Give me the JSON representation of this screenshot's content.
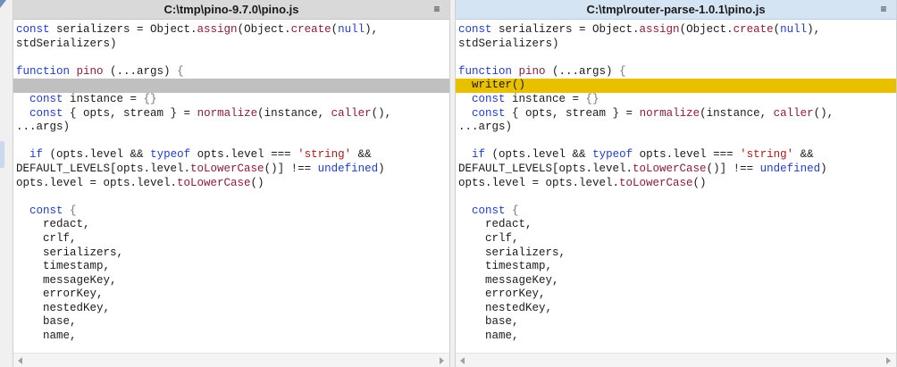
{
  "panes": [
    {
      "title": "C:\\tmp\\pino-9.7.0\\pino.js",
      "menu_glyph": "≡",
      "lines": [
        {
          "kind": "normal",
          "tokens": [
            {
              "t": "const",
              "c": "kw"
            },
            {
              "t": " serializers = Object.",
              "c": ""
            },
            {
              "t": "assign",
              "c": "fn"
            },
            {
              "t": "(Object.",
              "c": ""
            },
            {
              "t": "create",
              "c": "fn"
            },
            {
              "t": "(",
              "c": ""
            },
            {
              "t": "null",
              "c": "kw"
            },
            {
              "t": "),",
              "c": ""
            }
          ]
        },
        {
          "kind": "normal",
          "tokens": [
            {
              "t": "stdSerializers)",
              "c": ""
            }
          ]
        },
        {
          "kind": "normal",
          "tokens": []
        },
        {
          "kind": "normal",
          "tokens": [
            {
              "t": "function",
              "c": "kw"
            },
            {
              "t": " ",
              "c": ""
            },
            {
              "t": "pino",
              "c": "fn"
            },
            {
              "t": " (...args) ",
              "c": ""
            },
            {
              "t": "{",
              "c": "punc"
            }
          ]
        },
        {
          "kind": "placeholder",
          "tokens": []
        },
        {
          "kind": "normal",
          "tokens": [
            {
              "t": "  ",
              "c": ""
            },
            {
              "t": "const",
              "c": "kw"
            },
            {
              "t": " instance = ",
              "c": ""
            },
            {
              "t": "{}",
              "c": "punc"
            }
          ]
        },
        {
          "kind": "normal",
          "tokens": [
            {
              "t": "  ",
              "c": ""
            },
            {
              "t": "const",
              "c": "kw"
            },
            {
              "t": " { opts, stream } = ",
              "c": ""
            },
            {
              "t": "normalize",
              "c": "fn"
            },
            {
              "t": "(instance, ",
              "c": ""
            },
            {
              "t": "caller",
              "c": "fn"
            },
            {
              "t": "(),",
              "c": ""
            }
          ]
        },
        {
          "kind": "normal",
          "tokens": [
            {
              "t": "...args)",
              "c": ""
            }
          ]
        },
        {
          "kind": "normal",
          "tokens": []
        },
        {
          "kind": "normal",
          "tokens": [
            {
              "t": "  ",
              "c": ""
            },
            {
              "t": "if",
              "c": "kw"
            },
            {
              "t": " (opts.level && ",
              "c": ""
            },
            {
              "t": "typeof",
              "c": "kw"
            },
            {
              "t": " opts.level === ",
              "c": ""
            },
            {
              "t": "'string'",
              "c": "str"
            },
            {
              "t": " &&",
              "c": ""
            }
          ]
        },
        {
          "kind": "normal",
          "tokens": [
            {
              "t": "DEFAULT_LEVELS[opts.level.",
              "c": ""
            },
            {
              "t": "toLowerCase",
              "c": "fn"
            },
            {
              "t": "()] !== ",
              "c": ""
            },
            {
              "t": "undefined",
              "c": "kw"
            },
            {
              "t": ")",
              "c": ""
            }
          ]
        },
        {
          "kind": "normal",
          "tokens": [
            {
              "t": "opts.level = opts.level.",
              "c": ""
            },
            {
              "t": "toLowerCase",
              "c": "fn"
            },
            {
              "t": "()",
              "c": ""
            }
          ]
        },
        {
          "kind": "normal",
          "tokens": []
        },
        {
          "kind": "normal",
          "tokens": [
            {
              "t": "  ",
              "c": ""
            },
            {
              "t": "const",
              "c": "kw"
            },
            {
              "t": " ",
              "c": ""
            },
            {
              "t": "{",
              "c": "punc"
            }
          ]
        },
        {
          "kind": "normal",
          "tokens": [
            {
              "t": "    redact,",
              "c": ""
            }
          ]
        },
        {
          "kind": "normal",
          "tokens": [
            {
              "t": "    crlf,",
              "c": ""
            }
          ]
        },
        {
          "kind": "normal",
          "tokens": [
            {
              "t": "    serializers,",
              "c": ""
            }
          ]
        },
        {
          "kind": "normal",
          "tokens": [
            {
              "t": "    timestamp,",
              "c": ""
            }
          ]
        },
        {
          "kind": "normal",
          "tokens": [
            {
              "t": "    messageKey,",
              "c": ""
            }
          ]
        },
        {
          "kind": "normal",
          "tokens": [
            {
              "t": "    errorKey,",
              "c": ""
            }
          ]
        },
        {
          "kind": "normal",
          "tokens": [
            {
              "t": "    nestedKey,",
              "c": ""
            }
          ]
        },
        {
          "kind": "normal",
          "tokens": [
            {
              "t": "    base,",
              "c": ""
            }
          ]
        },
        {
          "kind": "normal",
          "tokens": [
            {
              "t": "    name,",
              "c": ""
            }
          ]
        }
      ]
    },
    {
      "title": "C:\\tmp\\router-parse-1.0.1\\pino.js",
      "menu_glyph": "≡",
      "lines": [
        {
          "kind": "normal",
          "tokens": [
            {
              "t": "const",
              "c": "kw"
            },
            {
              "t": " serializers = Object.",
              "c": ""
            },
            {
              "t": "assign",
              "c": "fn"
            },
            {
              "t": "(Object.",
              "c": ""
            },
            {
              "t": "create",
              "c": "fn"
            },
            {
              "t": "(",
              "c": ""
            },
            {
              "t": "null",
              "c": "kw"
            },
            {
              "t": "),",
              "c": ""
            }
          ]
        },
        {
          "kind": "normal",
          "tokens": [
            {
              "t": "stdSerializers)",
              "c": ""
            }
          ]
        },
        {
          "kind": "normal",
          "tokens": []
        },
        {
          "kind": "normal",
          "tokens": [
            {
              "t": "function",
              "c": "kw"
            },
            {
              "t": " ",
              "c": ""
            },
            {
              "t": "pino",
              "c": "fn"
            },
            {
              "t": " (...args) ",
              "c": ""
            },
            {
              "t": "{",
              "c": "punc"
            }
          ]
        },
        {
          "kind": "added",
          "tokens": [
            {
              "t": "  writer()",
              "c": ""
            }
          ]
        },
        {
          "kind": "normal",
          "tokens": [
            {
              "t": "  ",
              "c": ""
            },
            {
              "t": "const",
              "c": "kw"
            },
            {
              "t": " instance = ",
              "c": ""
            },
            {
              "t": "{}",
              "c": "punc"
            }
          ]
        },
        {
          "kind": "normal",
          "tokens": [
            {
              "t": "  ",
              "c": ""
            },
            {
              "t": "const",
              "c": "kw"
            },
            {
              "t": " { opts, stream } = ",
              "c": ""
            },
            {
              "t": "normalize",
              "c": "fn"
            },
            {
              "t": "(instance, ",
              "c": ""
            },
            {
              "t": "caller",
              "c": "fn"
            },
            {
              "t": "(),",
              "c": ""
            }
          ]
        },
        {
          "kind": "normal",
          "tokens": [
            {
              "t": "...args)",
              "c": ""
            }
          ]
        },
        {
          "kind": "normal",
          "tokens": []
        },
        {
          "kind": "normal",
          "tokens": [
            {
              "t": "  ",
              "c": ""
            },
            {
              "t": "if",
              "c": "kw"
            },
            {
              "t": " (opts.level && ",
              "c": ""
            },
            {
              "t": "typeof",
              "c": "kw"
            },
            {
              "t": " opts.level === ",
              "c": ""
            },
            {
              "t": "'string'",
              "c": "str"
            },
            {
              "t": " &&",
              "c": ""
            }
          ]
        },
        {
          "kind": "normal",
          "tokens": [
            {
              "t": "DEFAULT_LEVELS[opts.level.",
              "c": ""
            },
            {
              "t": "toLowerCase",
              "c": "fn"
            },
            {
              "t": "()] !== ",
              "c": ""
            },
            {
              "t": "undefined",
              "c": "kw"
            },
            {
              "t": ")",
              "c": ""
            }
          ]
        },
        {
          "kind": "normal",
          "tokens": [
            {
              "t": "opts.level = opts.level.",
              "c": ""
            },
            {
              "t": "toLowerCase",
              "c": "fn"
            },
            {
              "t": "()",
              "c": ""
            }
          ]
        },
        {
          "kind": "normal",
          "tokens": []
        },
        {
          "kind": "normal",
          "tokens": [
            {
              "t": "  ",
              "c": ""
            },
            {
              "t": "const",
              "c": "kw"
            },
            {
              "t": " ",
              "c": ""
            },
            {
              "t": "{",
              "c": "punc"
            }
          ]
        },
        {
          "kind": "normal",
          "tokens": [
            {
              "t": "    redact,",
              "c": ""
            }
          ]
        },
        {
          "kind": "normal",
          "tokens": [
            {
              "t": "    crlf,",
              "c": ""
            }
          ]
        },
        {
          "kind": "normal",
          "tokens": [
            {
              "t": "    serializers,",
              "c": ""
            }
          ]
        },
        {
          "kind": "normal",
          "tokens": [
            {
              "t": "    timestamp,",
              "c": ""
            }
          ]
        },
        {
          "kind": "normal",
          "tokens": [
            {
              "t": "    messageKey,",
              "c": ""
            }
          ]
        },
        {
          "kind": "normal",
          "tokens": [
            {
              "t": "    errorKey,",
              "c": ""
            }
          ]
        },
        {
          "kind": "normal",
          "tokens": [
            {
              "t": "    nestedKey,",
              "c": ""
            }
          ]
        },
        {
          "kind": "normal",
          "tokens": [
            {
              "t": "    base,",
              "c": ""
            }
          ]
        },
        {
          "kind": "normal",
          "tokens": [
            {
              "t": "    name,",
              "c": ""
            }
          ]
        }
      ]
    }
  ],
  "icons": {
    "pane_menu": "hamburger-menu-icon",
    "scroll_left": "scroll-left-arrow-icon",
    "scroll_right": "scroll-right-arrow-icon"
  },
  "colors": {
    "keyword": "#1f3ec8",
    "function": "#8c1c3a",
    "string": "#b01818",
    "placeholder_line": "#c0c0c0",
    "added_line": "#e8c000",
    "right_title_bg": "#d5e4f3"
  }
}
